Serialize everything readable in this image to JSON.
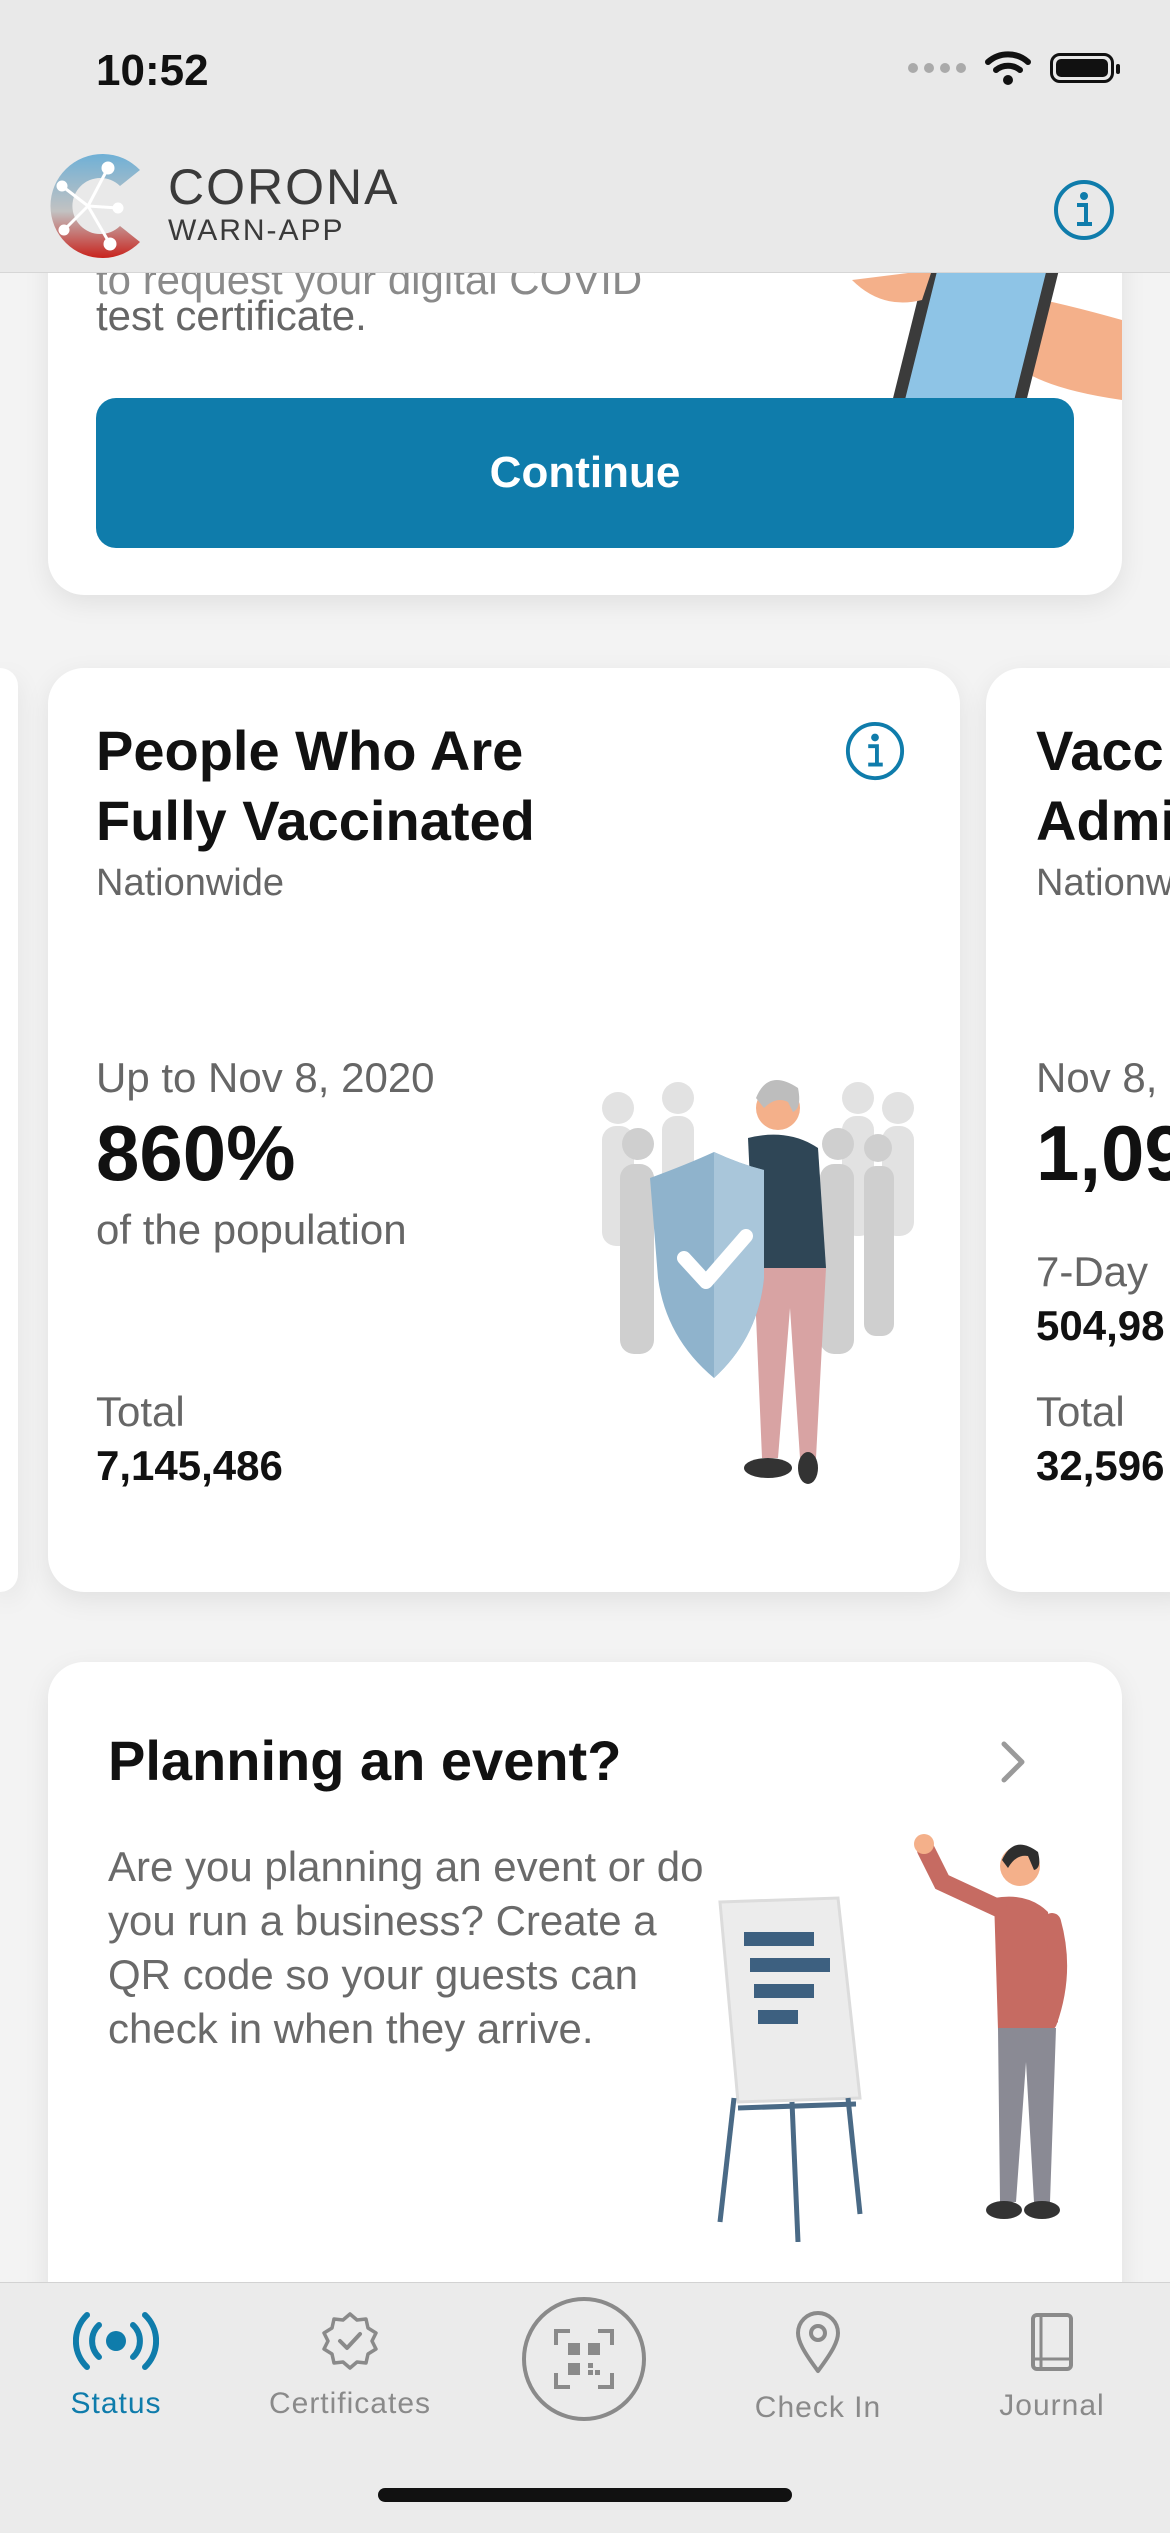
{
  "status_bar": {
    "time": "10:52"
  },
  "header": {
    "brand_main": "CORONA",
    "brand_sub": "WARN-APP",
    "info_icon": "info-icon"
  },
  "test_card": {
    "text_cut": "to request your digital COVID",
    "text": "test certificate.",
    "button_label": "Continue"
  },
  "stats": [
    {
      "title_line1": "People Who Are",
      "title_line2": "Fully Vaccinated",
      "subtitle": "Nationwide",
      "date": "Up to Nov 8, 2020",
      "big_value": "860%",
      "description": "of the population",
      "total_label": "Total",
      "total_value": "7,145,486"
    },
    {
      "title_line1": "Vacc",
      "title_line2": "Admi",
      "subtitle": "Nationw",
      "date": "Nov 8,",
      "big_value": "1,09",
      "seven_day_label": "7-Day",
      "seven_day_value": "504,98",
      "total_label": "Total",
      "total_value": "32,596"
    }
  ],
  "event_card": {
    "title": "Planning an event?",
    "description": "Are you planning an event or do you run a business? Create a QR code so your guests can check in when they arrive."
  },
  "tabbar": {
    "tabs": [
      {
        "label": "Status",
        "icon": "broadcast-icon",
        "active": true
      },
      {
        "label": "Certificates",
        "icon": "certificate-badge-icon",
        "active": false
      },
      {
        "label": "",
        "icon": "qr-scan-icon",
        "active": false
      },
      {
        "label": "Check In",
        "icon": "location-pin-icon",
        "active": false
      },
      {
        "label": "Journal",
        "icon": "journal-book-icon",
        "active": false
      }
    ]
  },
  "colors": {
    "accent": "#0f7cab",
    "background": "#f3f3f3",
    "card": "#ffffff"
  }
}
